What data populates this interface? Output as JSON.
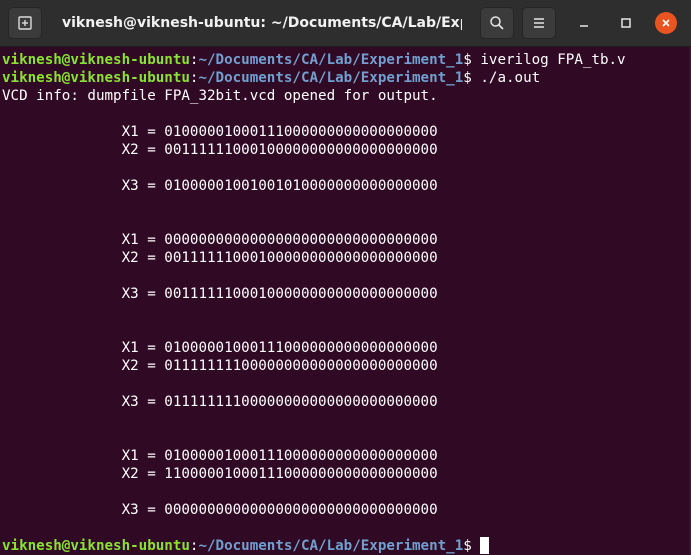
{
  "window": {
    "title": "viknesh@viknesh-ubuntu: ~/Documents/CA/Lab/Expe..."
  },
  "icons": {
    "new_tab": "new-tab-icon",
    "search": "search-icon",
    "menu": "hamburger-menu-icon",
    "minimize": "minimize-icon",
    "maximize": "maximize-icon",
    "close": "close-icon"
  },
  "colors": {
    "background": "#300a24",
    "user": "#8ae234",
    "path": "#729fcf",
    "close": "#e95420"
  },
  "prompt": {
    "user": "viknesh@viknesh-ubuntu",
    "colon": ":",
    "path": "~/Documents/CA/Lab/Experiment_1",
    "symbol": "$ "
  },
  "commands": [
    "iverilog FPA_tb.v",
    "./a.out",
    ""
  ],
  "output": {
    "vcd_info": "VCD info: dumpfile FPA_32bit.vcd opened for output.",
    "blocks": [
      {
        "x1": "              X1 = 01000001000111000000000000000000",
        "x2": "              X2 = 00111111000100000000000000000000",
        "x3": "              X3 = 01000001001001010000000000000000"
      },
      {
        "x1": "              X1 = 00000000000000000000000000000000",
        "x2": "              X2 = 00111111000100000000000000000000",
        "x3": "              X3 = 00111111000100000000000000000000"
      },
      {
        "x1": "              X1 = 01000001000111000000000000000000",
        "x2": "              X2 = 01111111100000000000000000000000",
        "x3": "              X3 = 01111111100000000000000000000000"
      },
      {
        "x1": "              X1 = 01000001000111000000000000000000",
        "x2": "              X2 = 11000001000111000000000000000000",
        "x3": "              X3 = 00000000000000000000000000000000"
      }
    ]
  }
}
